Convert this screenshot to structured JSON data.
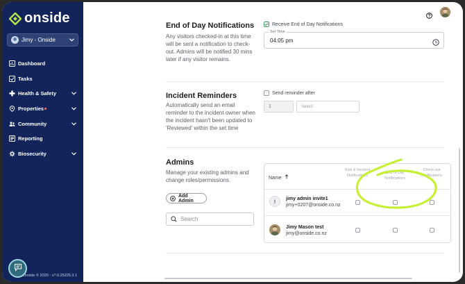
{
  "sidebar": {
    "logo_text": "onside",
    "user_selector": "Jimy - Onside",
    "nav": [
      {
        "label": "Dashboard"
      },
      {
        "label": "Tasks"
      },
      {
        "label": "Health & Safety"
      },
      {
        "label": "Properties"
      },
      {
        "label": "Community"
      },
      {
        "label": "Reporting"
      },
      {
        "label": "Biosecurity"
      }
    ],
    "version": "Onside © 2025 - v7.0.25225.3.1"
  },
  "end_of_day": {
    "title": "End of Day Notifications",
    "description": "Any visitors checked-in at this time will be sent a notification to check-out. Admins will be notified 30 mins later if any visitor remains.",
    "checkbox_label": "Receive End of Day Notifications",
    "checked": true,
    "time_label": "Set Time",
    "time_value": "04:05 pm"
  },
  "incident": {
    "title": "Incident Reminders",
    "description": "Automatically send an email reminder to the incident owner when the incident hasn't been updated to 'Reviewed' within the set time",
    "checkbox_label": "Send reminder after",
    "checked": false,
    "number_value": "1",
    "select_placeholder": "Select"
  },
  "admins": {
    "title": "Admins",
    "description": "Manage your existing admins and change roles/permissions.",
    "add_button": "Add Admin",
    "search_placeholder": "Search",
    "table": {
      "name_header": "Name",
      "columns": [
        "Risk & Incident Notifications",
        "End of Day Notifications",
        "Check-out Notifications"
      ],
      "rows": [
        {
          "initials": "ji",
          "name": "jimy admin invite1",
          "email": "jimy+0207@onside.co.nz"
        },
        {
          "initials": "",
          "name": "Jimy Mason test",
          "email": "jimy@onside.co.nz"
        }
      ]
    }
  },
  "colors": {
    "sidebar": "#12245a",
    "logo_accent": "#b6e34c",
    "annotation": "#c6f032",
    "check": "#3c9a5f"
  }
}
